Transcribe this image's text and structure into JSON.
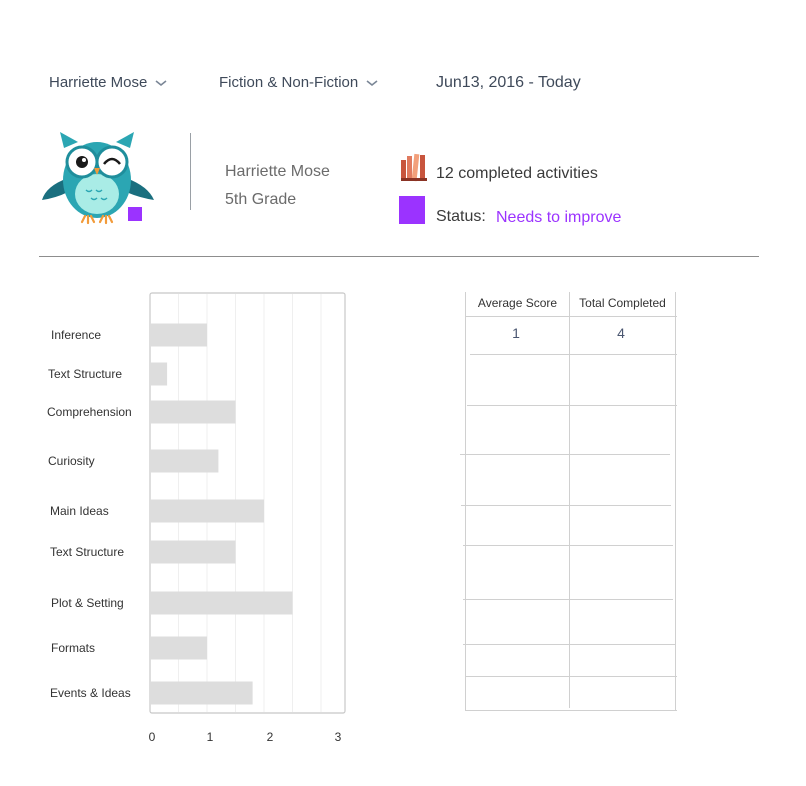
{
  "filters": {
    "student": "Harriette Mose",
    "category": "Fiction & Non-Fiction",
    "date_range": "Jun13, 2016 - Today"
  },
  "profile": {
    "avatar_icon": "owl-mascot-icon",
    "badge_color": "#9b33ff",
    "name": "Harriette Mose",
    "grade": "5th Grade"
  },
  "summary": {
    "books_icon": "books-icon",
    "activities": "12 completed activities",
    "status_label": "Status:",
    "status_value": "Needs to improve",
    "status_color": "#9b33ff"
  },
  "chart_data": {
    "type": "bar",
    "orientation": "horizontal",
    "categories": [
      "Inference",
      "Text Structure",
      "Comprehension",
      "Curiosity",
      "Main Ideas",
      "Text Structure",
      "Plot & Setting",
      "Formats",
      "Events & Ideas"
    ],
    "values": [
      1.0,
      0.3,
      1.5,
      1.2,
      2.0,
      1.5,
      2.5,
      1.0,
      1.8
    ],
    "xticks": [
      "0",
      "1",
      "2",
      "3"
    ],
    "xlim": [
      0,
      3.4
    ],
    "bar_color": "#dddddd",
    "grid": true
  },
  "table": {
    "headers": [
      "Average Score",
      "Total Completed"
    ],
    "rows": [
      [
        "1",
        "4"
      ]
    ]
  }
}
